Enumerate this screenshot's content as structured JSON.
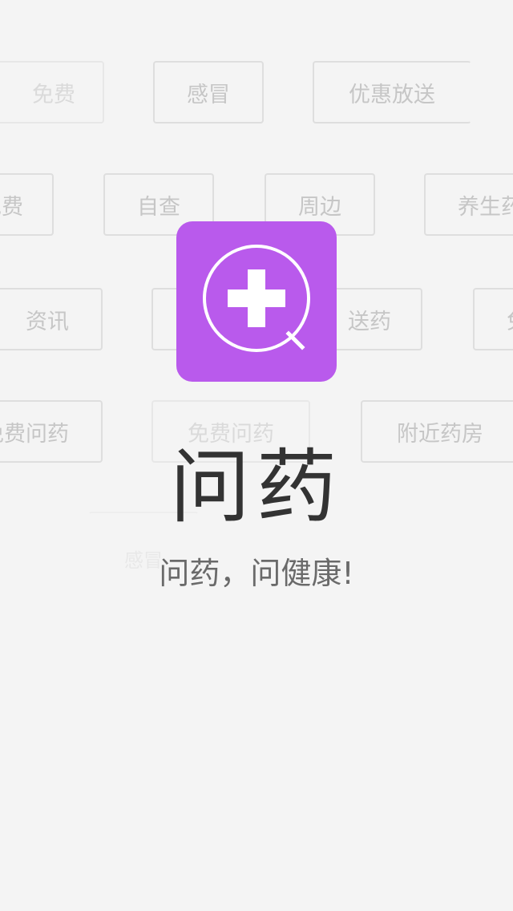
{
  "colors": {
    "background": "#f4f4f4",
    "brand_purple": "#b95aec",
    "tag_border": "#dedede",
    "tag_text": "#c6c6c6",
    "title_text": "#333333",
    "tagline_text": "#6a6a6a"
  },
  "background_tags": [
    {
      "label": "免费"
    },
    {
      "label": "感冒"
    },
    {
      "label": "优惠放送"
    },
    {
      "label": "免费"
    },
    {
      "label": "自查"
    },
    {
      "label": "周边"
    },
    {
      "label": "养生药"
    },
    {
      "label": "资讯"
    },
    {
      "label": "送药"
    },
    {
      "label": "免"
    },
    {
      "label": "免费问药"
    },
    {
      "label": "免费问药"
    },
    {
      "label": "附近药房"
    },
    {
      "label": "感冒"
    }
  ],
  "logo": {
    "icon": "plus-magnifier-icon"
  },
  "app": {
    "title": "问药",
    "tagline": "问药，问健康!"
  }
}
